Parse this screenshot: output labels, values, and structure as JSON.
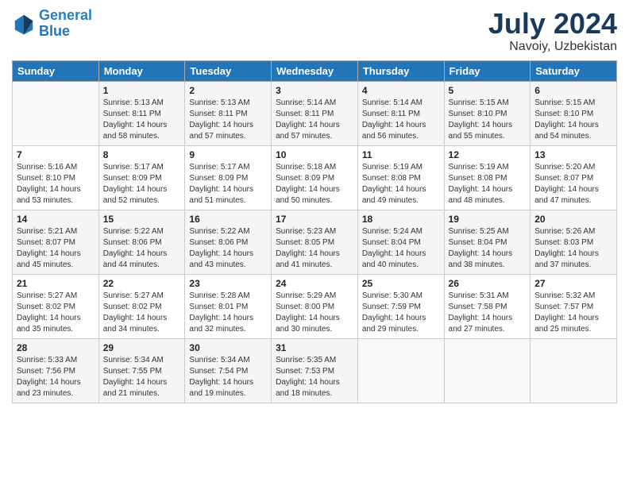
{
  "header": {
    "logo_line1": "General",
    "logo_line2": "Blue",
    "month_year": "July 2024",
    "location": "Navoiy, Uzbekistan"
  },
  "weekdays": [
    "Sunday",
    "Monday",
    "Tuesday",
    "Wednesday",
    "Thursday",
    "Friday",
    "Saturday"
  ],
  "weeks": [
    [
      {
        "day": "",
        "info": ""
      },
      {
        "day": "1",
        "info": "Sunrise: 5:13 AM\nSunset: 8:11 PM\nDaylight: 14 hours\nand 58 minutes."
      },
      {
        "day": "2",
        "info": "Sunrise: 5:13 AM\nSunset: 8:11 PM\nDaylight: 14 hours\nand 57 minutes."
      },
      {
        "day": "3",
        "info": "Sunrise: 5:14 AM\nSunset: 8:11 PM\nDaylight: 14 hours\nand 57 minutes."
      },
      {
        "day": "4",
        "info": "Sunrise: 5:14 AM\nSunset: 8:11 PM\nDaylight: 14 hours\nand 56 minutes."
      },
      {
        "day": "5",
        "info": "Sunrise: 5:15 AM\nSunset: 8:10 PM\nDaylight: 14 hours\nand 55 minutes."
      },
      {
        "day": "6",
        "info": "Sunrise: 5:15 AM\nSunset: 8:10 PM\nDaylight: 14 hours\nand 54 minutes."
      }
    ],
    [
      {
        "day": "7",
        "info": "Sunrise: 5:16 AM\nSunset: 8:10 PM\nDaylight: 14 hours\nand 53 minutes."
      },
      {
        "day": "8",
        "info": "Sunrise: 5:17 AM\nSunset: 8:09 PM\nDaylight: 14 hours\nand 52 minutes."
      },
      {
        "day": "9",
        "info": "Sunrise: 5:17 AM\nSunset: 8:09 PM\nDaylight: 14 hours\nand 51 minutes."
      },
      {
        "day": "10",
        "info": "Sunrise: 5:18 AM\nSunset: 8:09 PM\nDaylight: 14 hours\nand 50 minutes."
      },
      {
        "day": "11",
        "info": "Sunrise: 5:19 AM\nSunset: 8:08 PM\nDaylight: 14 hours\nand 49 minutes."
      },
      {
        "day": "12",
        "info": "Sunrise: 5:19 AM\nSunset: 8:08 PM\nDaylight: 14 hours\nand 48 minutes."
      },
      {
        "day": "13",
        "info": "Sunrise: 5:20 AM\nSunset: 8:07 PM\nDaylight: 14 hours\nand 47 minutes."
      }
    ],
    [
      {
        "day": "14",
        "info": "Sunrise: 5:21 AM\nSunset: 8:07 PM\nDaylight: 14 hours\nand 45 minutes."
      },
      {
        "day": "15",
        "info": "Sunrise: 5:22 AM\nSunset: 8:06 PM\nDaylight: 14 hours\nand 44 minutes."
      },
      {
        "day": "16",
        "info": "Sunrise: 5:22 AM\nSunset: 8:06 PM\nDaylight: 14 hours\nand 43 minutes."
      },
      {
        "day": "17",
        "info": "Sunrise: 5:23 AM\nSunset: 8:05 PM\nDaylight: 14 hours\nand 41 minutes."
      },
      {
        "day": "18",
        "info": "Sunrise: 5:24 AM\nSunset: 8:04 PM\nDaylight: 14 hours\nand 40 minutes."
      },
      {
        "day": "19",
        "info": "Sunrise: 5:25 AM\nSunset: 8:04 PM\nDaylight: 14 hours\nand 38 minutes."
      },
      {
        "day": "20",
        "info": "Sunrise: 5:26 AM\nSunset: 8:03 PM\nDaylight: 14 hours\nand 37 minutes."
      }
    ],
    [
      {
        "day": "21",
        "info": "Sunrise: 5:27 AM\nSunset: 8:02 PM\nDaylight: 14 hours\nand 35 minutes."
      },
      {
        "day": "22",
        "info": "Sunrise: 5:27 AM\nSunset: 8:02 PM\nDaylight: 14 hours\nand 34 minutes."
      },
      {
        "day": "23",
        "info": "Sunrise: 5:28 AM\nSunset: 8:01 PM\nDaylight: 14 hours\nand 32 minutes."
      },
      {
        "day": "24",
        "info": "Sunrise: 5:29 AM\nSunset: 8:00 PM\nDaylight: 14 hours\nand 30 minutes."
      },
      {
        "day": "25",
        "info": "Sunrise: 5:30 AM\nSunset: 7:59 PM\nDaylight: 14 hours\nand 29 minutes."
      },
      {
        "day": "26",
        "info": "Sunrise: 5:31 AM\nSunset: 7:58 PM\nDaylight: 14 hours\nand 27 minutes."
      },
      {
        "day": "27",
        "info": "Sunrise: 5:32 AM\nSunset: 7:57 PM\nDaylight: 14 hours\nand 25 minutes."
      }
    ],
    [
      {
        "day": "28",
        "info": "Sunrise: 5:33 AM\nSunset: 7:56 PM\nDaylight: 14 hours\nand 23 minutes."
      },
      {
        "day": "29",
        "info": "Sunrise: 5:34 AM\nSunset: 7:55 PM\nDaylight: 14 hours\nand 21 minutes."
      },
      {
        "day": "30",
        "info": "Sunrise: 5:34 AM\nSunset: 7:54 PM\nDaylight: 14 hours\nand 19 minutes."
      },
      {
        "day": "31",
        "info": "Sunrise: 5:35 AM\nSunset: 7:53 PM\nDaylight: 14 hours\nand 18 minutes."
      },
      {
        "day": "",
        "info": ""
      },
      {
        "day": "",
        "info": ""
      },
      {
        "day": "",
        "info": ""
      }
    ]
  ]
}
